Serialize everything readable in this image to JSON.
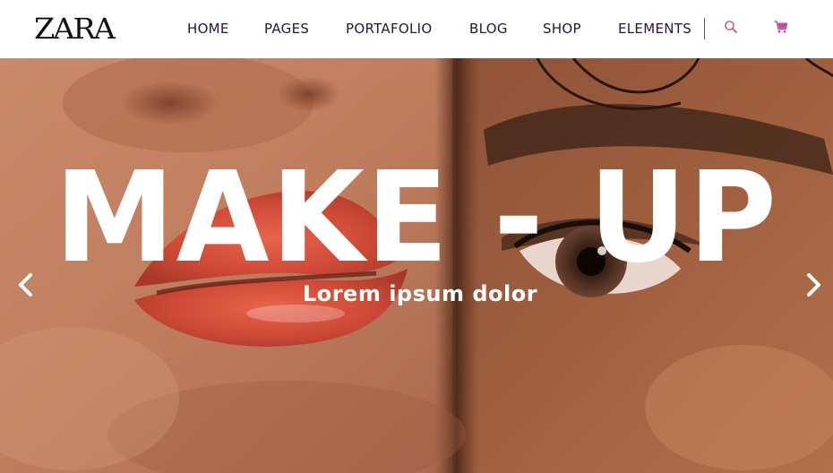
{
  "header": {
    "logo": "ZARA",
    "nav": [
      {
        "label": "HOME"
      },
      {
        "label": "PAGES"
      },
      {
        "label": "PORTAFOLIO"
      },
      {
        "label": "BLOG"
      },
      {
        "label": "SHOP"
      },
      {
        "label": "ELEMENTS"
      }
    ],
    "icons": {
      "search": "search-icon",
      "cart": "cart-icon"
    },
    "accent_color": "#c24a9a"
  },
  "hero": {
    "title": "MAKE - UP",
    "subtitle": "Lorem ipsum dolor",
    "prev_icon": "chevron-left-icon",
    "next_icon": "chevron-right-icon"
  }
}
